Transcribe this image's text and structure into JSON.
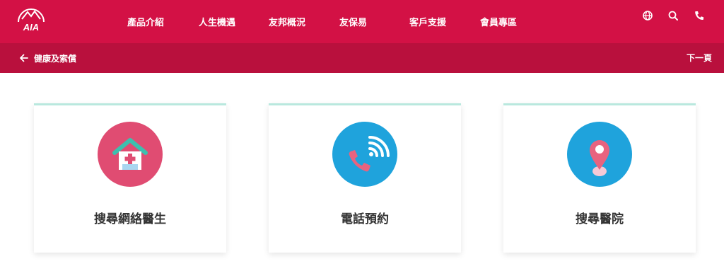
{
  "header": {
    "brand": "AIA",
    "nav": [
      "產品介紹",
      "人生機遇",
      "友邦概況",
      "友保易",
      "客戶支援",
      "會員專區"
    ],
    "utility_icons": [
      "globe-icon",
      "search-icon",
      "phone-icon"
    ]
  },
  "subheader": {
    "back_label": "健康及索償",
    "next_label": "下一頁"
  },
  "cards": [
    {
      "label": "搜尋網絡醫生",
      "icon": "clinic-icon",
      "circle_color": "#e04c72"
    },
    {
      "label": "電話預約",
      "icon": "phone-call-icon",
      "circle_color": "#1fa3dc"
    },
    {
      "label": "搜尋醫院",
      "icon": "location-pin-icon",
      "circle_color": "#1fa3dc"
    }
  ],
  "colors": {
    "brand_red": "#d31145",
    "subbar_red": "#b9103d",
    "card_accent": "#b9e8de"
  }
}
